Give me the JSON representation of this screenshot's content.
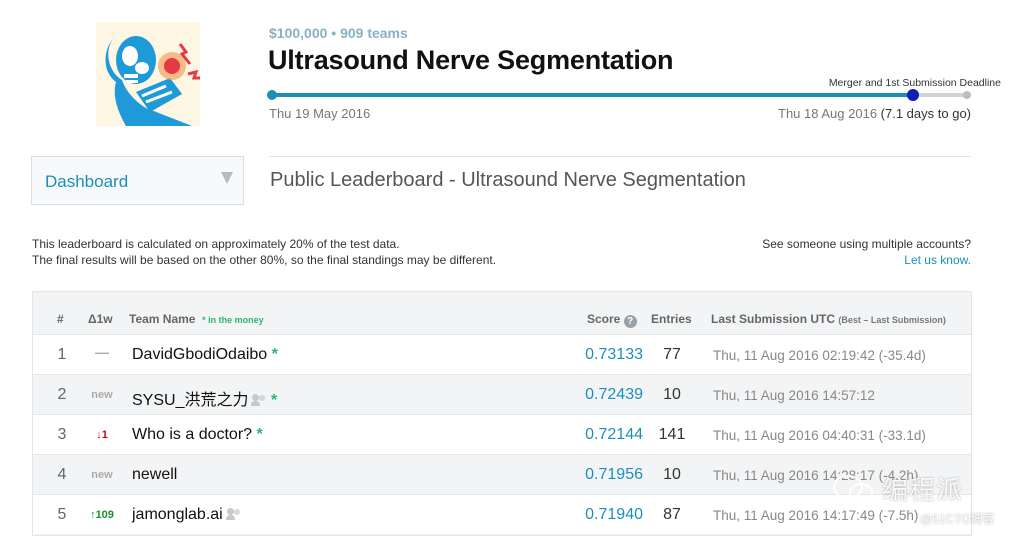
{
  "competition": {
    "prize_line": "$100,000 • 909 teams",
    "title": "Ultrasound Nerve Segmentation",
    "deadline_label": "Merger and 1st Submission Deadline",
    "start_date": "Thu 19 May 2016",
    "end_date": "Thu 18 Aug 2016",
    "time_left": "(7.1 days to go)",
    "progress": 0.92
  },
  "dashboard": {
    "label": "Dashboard"
  },
  "leaderboard": {
    "heading": "Public Leaderboard - Ultrasound Nerve Segmentation",
    "note_line1": "This leaderboard is calculated on approximately 20% of the test data.",
    "note_line2": "The final results will be based on the other 80%, so the final standings may be different.",
    "multi_q": "See someone using multiple accounts?",
    "multi_link": "Let us know.",
    "columns": {
      "rank": "#",
      "delta": "Δ1w",
      "team": "Team Name",
      "money_note": "* in the money",
      "score": "Score",
      "entries": "Entries",
      "last": "Last Submission UTC",
      "last_note": "(Best – Last Submission)"
    },
    "rows": [
      {
        "rank": "1",
        "delta": "—",
        "delta_type": "same",
        "team": "DavidGbodiOdaibo",
        "star": "*",
        "group": false,
        "score": "0.73133",
        "entries": "77",
        "last": "Thu, 11 Aug 2016 02:19:42 (-35.4d)"
      },
      {
        "rank": "2",
        "delta": "new",
        "delta_type": "new",
        "team": "SYSU_洪荒之力",
        "star": "*",
        "group": true,
        "score": "0.72439",
        "entries": "10",
        "last": "Thu, 11 Aug 2016 14:57:12"
      },
      {
        "rank": "3",
        "delta": "↓1",
        "delta_type": "down",
        "team": "Who is a doctor?",
        "star": "*",
        "group": false,
        "score": "0.72144",
        "entries": "141",
        "last": "Thu, 11 Aug 2016 04:40:31 (-33.1d)"
      },
      {
        "rank": "4",
        "delta": "new",
        "delta_type": "new",
        "team": "newell",
        "star": "",
        "group": false,
        "score": "0.71956",
        "entries": "10",
        "last": "Thu, 11 Aug 2016 14:28:17 (-4.2h)"
      },
      {
        "rank": "5",
        "delta": "↑109",
        "delta_type": "up",
        "team": "jamonglab.ai",
        "star": "",
        "group": true,
        "score": "0.71940",
        "entries": "87",
        "last": "Thu, 11 Aug 2016 14:17:49 (-7.5h)"
      }
    ]
  },
  "watermark": {
    "main": "编程派",
    "sub": "@51CTO博客"
  },
  "colors": {
    "accent": "#1b8fb8",
    "money": "#2bb673",
    "down": "#d0021b",
    "up": "#1a8f2b"
  }
}
